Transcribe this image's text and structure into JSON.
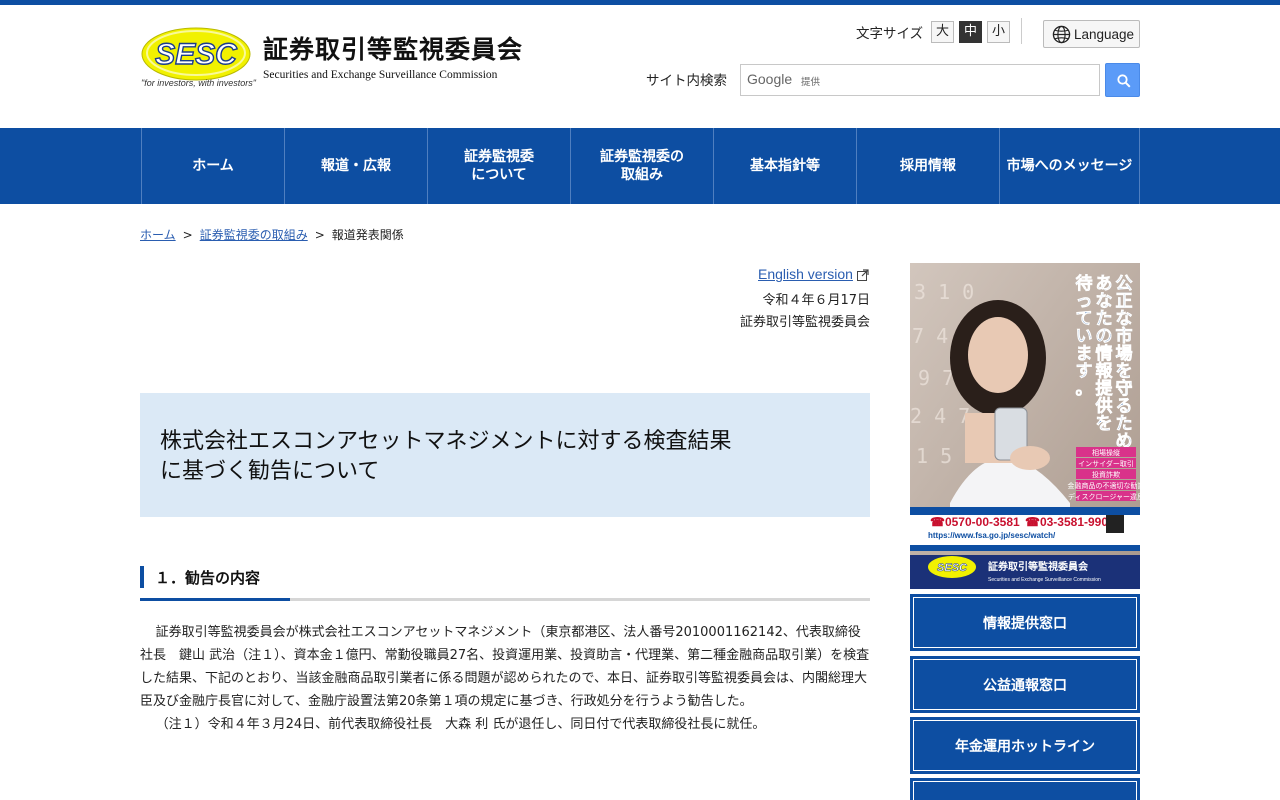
{
  "header": {
    "logo_text": "SESC",
    "logo_tagline": "\"for investors, with investors\"",
    "site_title": "証券取引等監視委員会",
    "site_subtitle": "Securities and Exchange Surveillance Commission",
    "font_size_label": "文字サイズ",
    "font_sizes": [
      "大",
      "中",
      "小"
    ],
    "font_size_selected": "中",
    "language_label": "Language",
    "search_label": "サイト内検索",
    "search_google": "Google",
    "search_provided": "提供"
  },
  "nav": {
    "items": [
      {
        "line1": "ホーム",
        "line2": ""
      },
      {
        "line1": "報道・広報",
        "line2": ""
      },
      {
        "line1": "証券監視委",
        "line2": "について"
      },
      {
        "line1": "証券監視委の",
        "line2": "取組み"
      },
      {
        "line1": "基本指針等",
        "line2": ""
      },
      {
        "line1": "採用情報",
        "line2": ""
      },
      {
        "line1": "市場へのメッセージ",
        "line2": ""
      }
    ]
  },
  "breadcrumb": {
    "items": [
      "ホーム",
      "証券監視委の取組み",
      "報道発表関係"
    ],
    "separator": ">"
  },
  "main": {
    "english_link": "English version",
    "date": "令和４年６月17日",
    "organization": "証券取引等監視委員会",
    "title_line1": "株式会社エスコンアセットマネジメントに対する検査結果",
    "title_line2": "に基づく勧告について",
    "section1_heading": "１．勧告の内容",
    "paragraph1": "証券取引等監視委員会が株式会社エスコンアセットマネジメント（東京都港区、法人番号2010001162142、代表取締役社長　鍵山 武治（注１）、資本金１億円、常勤役職員27名、投資運用業、投資助言・代理業、第二種金融商品取引業）を検査した結果、下記のとおり、当該金融商品取引業者に係る問題が認められたので、本日、証券取引等監視委員会は、内閣総理大臣及び金融庁長官に対して、金融庁設置法第20条第１項の規定に基づき、行政処分を行うよう勧告した。",
    "note1": "（注１）令和４年３月24日、前代表取締役社長　大森 利 氏が退任し、同日付で代表取締役社長に就任。"
  },
  "sidebar": {
    "banner": {
      "headline_col1": "公正な市場を守るため、",
      "headline_col2": "あなたの情報提供を",
      "headline_col3": "待っています。",
      "tags": [
        "相場操縦",
        "インサイダー取引",
        "投資詐欺",
        "金融商品の不適切な勧誘",
        "ディスクロージャー違反"
      ],
      "phone1": "0570-00-3581",
      "phone2": "03-3581-9909",
      "url": "https://www.fsa.go.jp/sesc/watch/",
      "footer_jp": "証券取引等監視委員会",
      "footer_en": "Securities and Exchange Surveillance Commission",
      "footer_logo": "SESC"
    },
    "buttons": [
      "情報提供窓口",
      "公益通報窓口",
      "年金運用ホットライン"
    ]
  },
  "colors": {
    "brand_blue": "#0d4ea2",
    "title_bg": "#dbe9f6",
    "link": "#2a5db0",
    "logo_yellow": "#e6e600"
  }
}
